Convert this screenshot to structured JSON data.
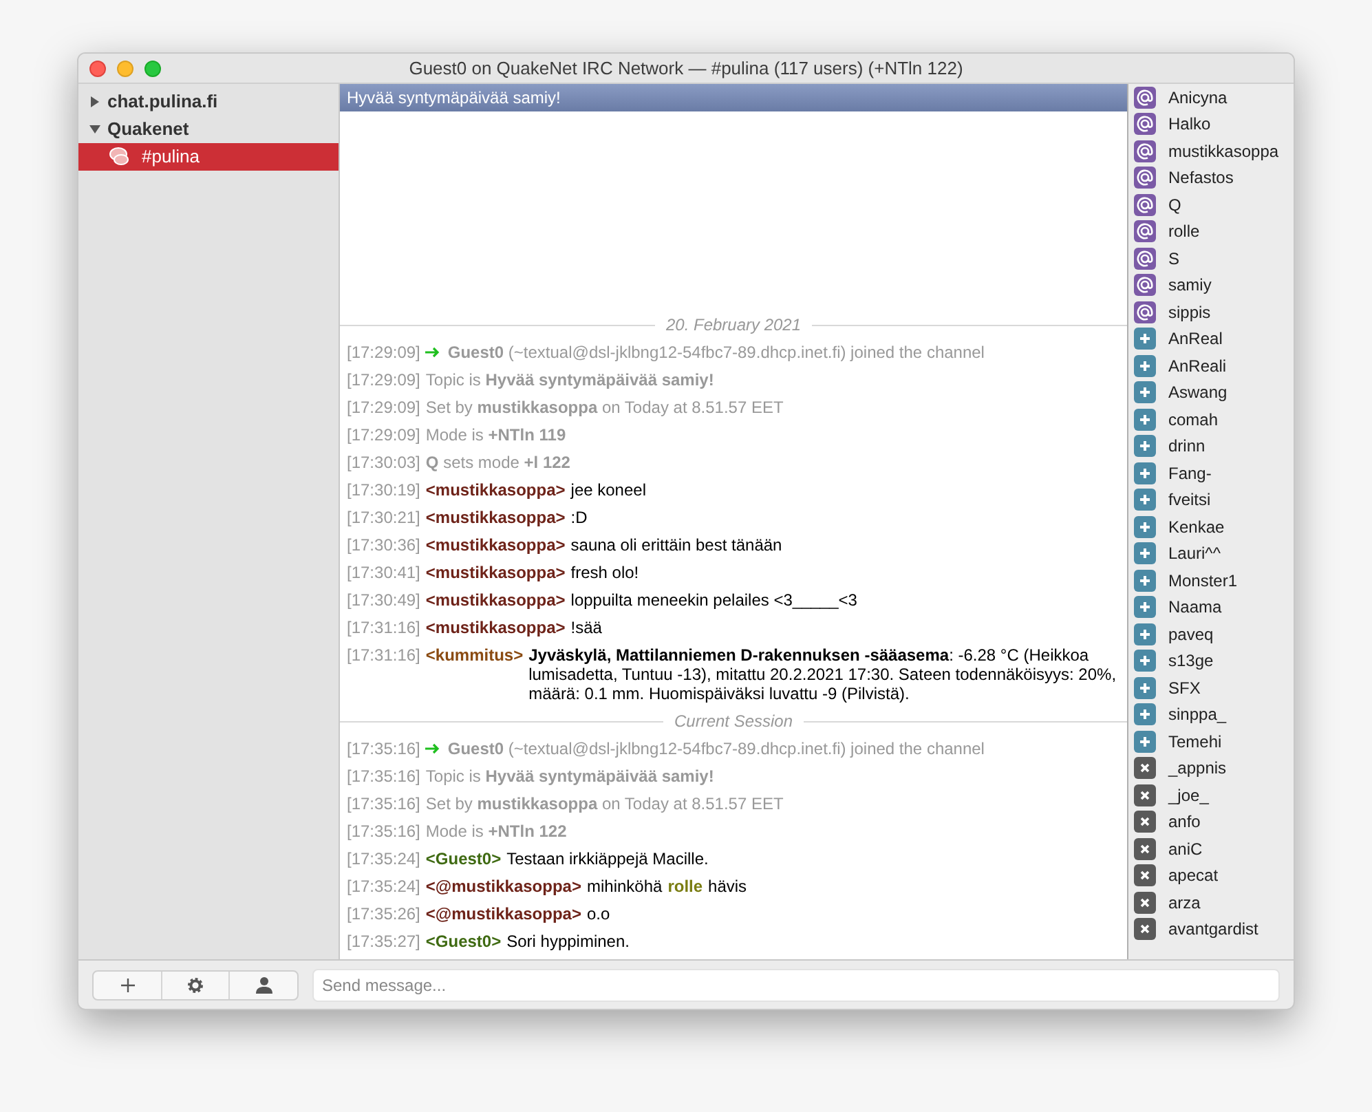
{
  "window": {
    "title": "Guest0 on QuakeNet IRC Network — #pulina (117 users) (+NTln 122)"
  },
  "sidebar": {
    "items": [
      {
        "label": "chat.pulina.fi",
        "expanded": false
      },
      {
        "label": "Quakenet",
        "expanded": true,
        "children": [
          {
            "label": "#pulina",
            "selected": true
          }
        ]
      }
    ]
  },
  "topic": "Hyvää syntymäpäivää samiy!",
  "log": [
    {
      "kind": "divider",
      "label": "20. February 2021"
    },
    {
      "kind": "join",
      "time": "[17:29:09]",
      "text": "**Guest0** (~textual@dsl-jklbng12-54fbc7-89.dhcp.inet.fi) joined the channel"
    },
    {
      "kind": "event",
      "time": "[17:29:09]",
      "text": "Topic is **Hyvää syntymäpäivää samiy!**"
    },
    {
      "kind": "event",
      "time": "[17:29:09]",
      "text": "Set by **mustikkasoppa** on Today at 8.51.57 EET"
    },
    {
      "kind": "event",
      "time": "[17:29:09]",
      "text": "Mode is **+NTln 119**"
    },
    {
      "kind": "event",
      "time": "[17:30:03]",
      "text": "**Q** sets mode **+l 122**"
    },
    {
      "kind": "message",
      "time": "[17:30:19]",
      "nick": "<mustikkasoppa>",
      "color": "#6e2319",
      "text": "jee koneel"
    },
    {
      "kind": "message",
      "time": "[17:30:21]",
      "nick": "<mustikkasoppa>",
      "color": "#6e2319",
      "text": ":D"
    },
    {
      "kind": "message",
      "time": "[17:30:36]",
      "nick": "<mustikkasoppa>",
      "color": "#6e2319",
      "text": "sauna oli erittäin best tänään"
    },
    {
      "kind": "message",
      "time": "[17:30:41]",
      "nick": "<mustikkasoppa>",
      "color": "#6e2319",
      "text": "fresh olo!"
    },
    {
      "kind": "message",
      "time": "[17:30:49]",
      "nick": "<mustikkasoppa>",
      "color": "#6e2319",
      "text": "loppuilta meneekin pelailes <3_____<3"
    },
    {
      "kind": "message",
      "time": "[17:31:16]",
      "nick": "<mustikkasoppa>",
      "color": "#6e2319",
      "text": "!sää"
    },
    {
      "kind": "message",
      "time": "[17:31:16]",
      "nick": "<kummitus>",
      "color": "#8a4b12",
      "text": "**Jyväskylä, Mattilanniemen D-rakennuksen -sääasema**: -6.28 °C (Heikkoa lumisadetta, Tuntuu -13), mitattu 20.2.2021 17:30. Sateen todennäköisyys: 20%, määrä: 0.1 mm. Huomispäiväksi luvattu -9 (Pilvistä)."
    },
    {
      "kind": "divider",
      "label": "Current Session"
    },
    {
      "kind": "join",
      "time": "[17:35:16]",
      "text": "**Guest0** (~textual@dsl-jklbng12-54fbc7-89.dhcp.inet.fi) joined the channel"
    },
    {
      "kind": "event",
      "time": "[17:35:16]",
      "text": "Topic is **Hyvää syntymäpäivää samiy!**"
    },
    {
      "kind": "event",
      "time": "[17:35:16]",
      "text": "Set by **mustikkasoppa** on Today at 8.51.57 EET"
    },
    {
      "kind": "event",
      "time": "[17:35:16]",
      "text": "Mode is **+NTln 122**"
    },
    {
      "kind": "message",
      "time": "[17:35:24]",
      "nick": "<Guest0>",
      "color": "#3f6a12",
      "text": "Testaan irkkiäppejä Macille."
    },
    {
      "kind": "message",
      "time": "[17:35:24]",
      "nick": "<@mustikkasoppa>",
      "color": "#6e2319",
      "text": "mihinköhä",
      "mention": {
        "name": "rolle",
        "color": "#7a7d12"
      },
      "after": "hävis"
    },
    {
      "kind": "message",
      "time": "[17:35:26]",
      "nick": "<@mustikkasoppa>",
      "color": "#6e2319",
      "text": "o.o"
    },
    {
      "kind": "message",
      "time": "[17:35:27]",
      "nick": "<Guest0>",
      "color": "#3f6a12",
      "text": "Sori hyppiminen."
    }
  ],
  "users": [
    {
      "kind": "op",
      "name": "Anicyna"
    },
    {
      "kind": "op",
      "name": "Halko"
    },
    {
      "kind": "op",
      "name": "mustikkasoppa"
    },
    {
      "kind": "op",
      "name": "Nefastos"
    },
    {
      "kind": "op",
      "name": "Q"
    },
    {
      "kind": "op",
      "name": "rolle"
    },
    {
      "kind": "op",
      "name": "S"
    },
    {
      "kind": "op",
      "name": "samiy"
    },
    {
      "kind": "op",
      "name": "sippis"
    },
    {
      "kind": "voice",
      "name": "AnReal"
    },
    {
      "kind": "voice",
      "name": "AnReali"
    },
    {
      "kind": "voice",
      "name": "Aswang"
    },
    {
      "kind": "voice",
      "name": "comah"
    },
    {
      "kind": "voice",
      "name": "drinn"
    },
    {
      "kind": "voice",
      "name": "Fang-"
    },
    {
      "kind": "voice",
      "name": "fveitsi"
    },
    {
      "kind": "voice",
      "name": "Kenkae"
    },
    {
      "kind": "voice",
      "name": "Lauri^^"
    },
    {
      "kind": "voice",
      "name": "Monster1"
    },
    {
      "kind": "voice",
      "name": "Naama"
    },
    {
      "kind": "voice",
      "name": "paveq"
    },
    {
      "kind": "voice",
      "name": "s13ge"
    },
    {
      "kind": "voice",
      "name": "SFX"
    },
    {
      "kind": "voice",
      "name": "sinppa_"
    },
    {
      "kind": "voice",
      "name": "Temehi"
    },
    {
      "kind": "none",
      "name": "_appnis"
    },
    {
      "kind": "none",
      "name": "_joe_"
    },
    {
      "kind": "none",
      "name": "anfo"
    },
    {
      "kind": "none",
      "name": "aniC"
    },
    {
      "kind": "none",
      "name": "apecat"
    },
    {
      "kind": "none",
      "name": "arza"
    },
    {
      "kind": "none",
      "name": "avantgardist"
    }
  ],
  "input": {
    "placeholder": "Send message..."
  }
}
